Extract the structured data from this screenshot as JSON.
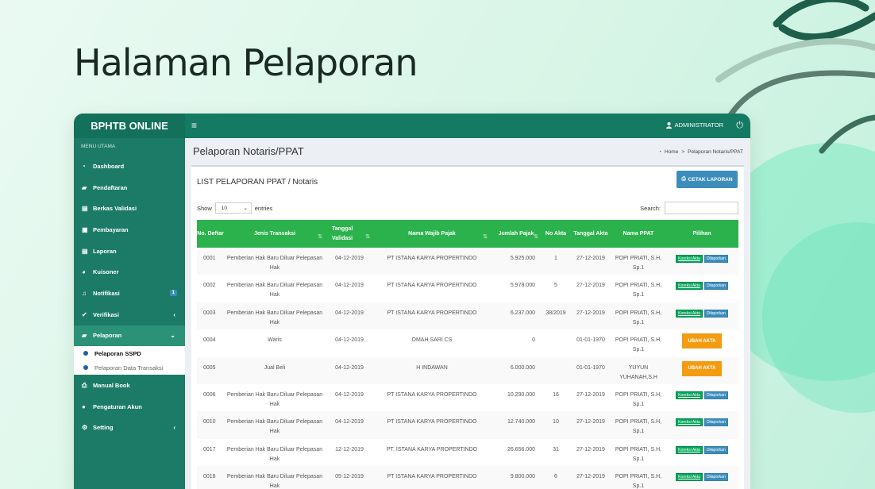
{
  "heading": "Halaman Pelaporan",
  "colors": {
    "brand": "#157a63",
    "sidebar": "#1b7b66",
    "table_header": "#2bb24c",
    "button_blue": "#3c8dbc",
    "button_orange": "#f39c12",
    "button_green": "#00a65a"
  },
  "topbar": {
    "brand": "BPHTB ONLINE",
    "menu_icon": "hamburger-icon",
    "user": "ADMINISTRATOR",
    "user_icon": "user-icon",
    "logout_icon": "power-icon"
  },
  "sidebar": {
    "header": "MENU UTAMA",
    "items": [
      {
        "label": "Dashboard",
        "icon": "dashboard-icon"
      },
      {
        "label": "Pendaftaran",
        "icon": "book-icon"
      },
      {
        "label": "Berkas Validasi",
        "icon": "file-icon"
      },
      {
        "label": "Pembayaran",
        "icon": "money-icon"
      },
      {
        "label": "Laporan",
        "icon": "file-icon"
      },
      {
        "label": "Kuisoner",
        "icon": "pie-chart-icon"
      },
      {
        "label": "Notifikasi",
        "icon": "bell-icon",
        "badge": "1"
      },
      {
        "label": "Verifikasi",
        "icon": "check-icon"
      },
      {
        "label": "Pelaporan",
        "icon": "book-icon"
      },
      {
        "label": "Manual Book",
        "icon": "print-icon"
      },
      {
        "label": "Pengaturan Akun",
        "icon": "user-icon"
      },
      {
        "label": "Setting",
        "icon": "gears-icon"
      }
    ],
    "submenu": [
      "Pelaporan SSPD",
      "Pelaporan Data Transaksi"
    ]
  },
  "content": {
    "title": "Pelaporan Notaris/PPAT",
    "breadcrumb": {
      "home": "Home",
      "separator": ">",
      "current": "Pelaporan Notaris/PPAT"
    }
  },
  "box": {
    "title": "LIST PELAPORAN PPAT / Notaris",
    "print_label": "CETAK LAPORAN",
    "show_label": "Show",
    "entries_value": "10",
    "entries_label": "entries",
    "search_label": "Search:"
  },
  "table": {
    "headers": [
      "No. Daftar",
      "Jenis Transaksi",
      "Tanggal Validasi",
      "Nama Wajib Pajak",
      "Jumlah Pajak",
      "No Akta",
      "Tanggal Akta",
      "Nama PPAT",
      "Pilihan"
    ],
    "action_labels": {
      "koreksi": "Koreksi Akta",
      "dilaporkan": "Dilaporkan",
      "ubah": "UBAH AKTA"
    },
    "rows": [
      {
        "no": "0001",
        "jenis": "Pemberian Hak Baru Diluar Pelepasan Hak",
        "tgl_validasi": "04-12-2019",
        "nama": "PT ISTANA KARYA PROPERTINDO",
        "jumlah": "5.925.000",
        "akta": "1",
        "tgl_akta": "27-12-2019",
        "ppat": "POPI PRIATI, S.H, Sp.1",
        "action": "pair"
      },
      {
        "no": "0002",
        "jenis": "Pemberian Hak Baru Diluar Pelepasan Hak",
        "tgl_validasi": "04-12-2019",
        "nama": "PT ISTANA KARYA PROPERTINDO",
        "jumlah": "5.978.000",
        "akta": "5",
        "tgl_akta": "27-12-2019",
        "ppat": "POPI PRIATI, S.H, Sp.1",
        "action": "pair"
      },
      {
        "no": "0003",
        "jenis": "Pemberian Hak Baru Diluar Pelepasan Hak",
        "tgl_validasi": "04-12-2019",
        "nama": "PT ISTANA KARYA PROPERTINDO",
        "jumlah": "6.237.000",
        "akta": "38/2019",
        "tgl_akta": "27-12-2019",
        "ppat": "POPI PRIATI, S.H, Sp.1",
        "action": "pair"
      },
      {
        "no": "0004",
        "jenis": "Waris",
        "tgl_validasi": "04-12-2019",
        "nama": "OMAH SARI CS",
        "jumlah": "0",
        "akta": "",
        "tgl_akta": "01-01-1970",
        "ppat": "POPI PRIATI, S.H, Sp.1",
        "action": "ubah"
      },
      {
        "no": "0005",
        "jenis": "Jual Beli",
        "tgl_validasi": "04-12-2019",
        "nama": "H INDAWAN",
        "jumlah": "6.000.000",
        "akta": "",
        "tgl_akta": "01-01-1970",
        "ppat": "YUYUN YUHANAH,S.H",
        "action": "ubah"
      },
      {
        "no": "0006",
        "jenis": "Pemberian Hak Baru Diluar Pelepasan Hak",
        "tgl_validasi": "04-12-2019",
        "nama": "PT ISTANA KARYA PROPERTINDO",
        "jumlah": "10.290.000",
        "akta": "16",
        "tgl_akta": "27-12-2019",
        "ppat": "POPI PRIATI, S.H, Sp.1",
        "action": "pair"
      },
      {
        "no": "0010",
        "jenis": "Pemberian Hak Baru Diluar Pelepasan Hak",
        "tgl_validasi": "04-12-2019",
        "nama": "PT ISTANA KARYA PROPERTINDO",
        "jumlah": "12.740.000",
        "akta": "10",
        "tgl_akta": "27-12-2019",
        "ppat": "POPI PRIATI, S.H, Sp.1",
        "action": "pair"
      },
      {
        "no": "0017",
        "jenis": "Pemberian Hak Baru Diluar Pelepasan Hak",
        "tgl_validasi": "12-12-2019",
        "nama": "PT. ISTANA KARYA PROPERTINDO",
        "jumlah": "26.656.000",
        "akta": "31",
        "tgl_akta": "27-12-2019",
        "ppat": "POPI PRIATI, S.H, Sp.1",
        "action": "pair"
      },
      {
        "no": "0018",
        "jenis": "Pemberian Hak Baru Diluar Pelepasan Hak",
        "tgl_validasi": "05-12-2019",
        "nama": "PT ISTANA KARYA PROPERTINDO",
        "jumlah": "9.800.000",
        "akta": "6",
        "tgl_akta": "27-12-2019",
        "ppat": "POPI PRIATI, S.H, Sp.1",
        "action": "pair"
      }
    ]
  }
}
